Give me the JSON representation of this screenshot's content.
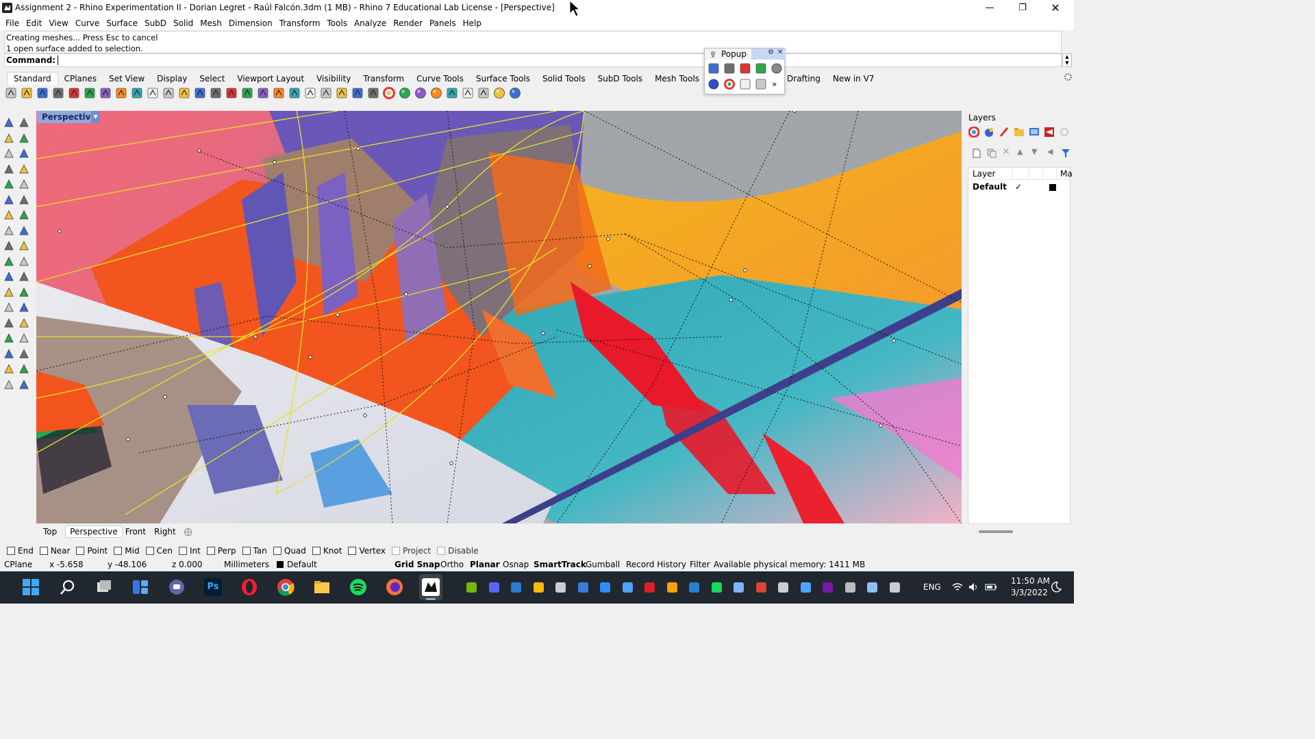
{
  "title_bar": {
    "title": "Assignment 2 - Rhino Experimentation II - Dorian Legret - Raúl Falcón.3dm (1 MB) - Rhino 7 Educational Lab License - [Perspective]",
    "minimize_icon": "minimize-icon",
    "maximize_icon": "restore-icon",
    "close_icon": "close-icon"
  },
  "menu": [
    "File",
    "Edit",
    "View",
    "Curve",
    "Surface",
    "SubD",
    "Solid",
    "Mesh",
    "Dimension",
    "Transform",
    "Tools",
    "Analyze",
    "Render",
    "Panels",
    "Help"
  ],
  "command": {
    "history": [
      "Creating meshes... Press Esc to cancel",
      "1 open surface added to selection."
    ],
    "prompt": "Command:",
    "value": ""
  },
  "toolbar_tabs": [
    "Standard",
    "CPlanes",
    "Set View",
    "Display",
    "Select",
    "Viewport Layout",
    "Visibility",
    "Transform",
    "Curve Tools",
    "Surface Tools",
    "Solid Tools",
    "SubD Tools",
    "Mesh Tools",
    "Drafting",
    "New in V7"
  ],
  "active_tab": "Standard",
  "standard_tools": [
    "new-icon",
    "open-icon",
    "save-icon",
    "print-icon",
    "import-icon",
    "cut-icon",
    "copy-icon",
    "paste-icon",
    "undo-icon",
    "pan-icon",
    "move-view-icon",
    "zoom-icon",
    "zoom-window-icon",
    "zoom-extents-icon",
    "zoom-selected-icon",
    "rotate-view-icon",
    "four-viewports-icon",
    "car-icon",
    "render-preview-icon",
    "snap-icon",
    "named-cplanes-icon",
    "light-icon",
    "lock-icon",
    "material-icon",
    "color-wheel-icon",
    "sphere-shaded-icon",
    "sphere-rendered-icon",
    "sphere-blue-icon",
    "brush-icon",
    "gear-options-icon",
    "grid-options-icon",
    "globe-icon",
    "help-icon"
  ],
  "popup": {
    "title": "Popup",
    "tools": [
      "lightbulb-icon",
      "lock-icon",
      "save-icon",
      "zoom-window-icon",
      "sphere-icon",
      "blue-sphere-icon",
      "color-wheel-icon",
      "bubbles-icon",
      "brush-icon",
      "more-icon"
    ],
    "more": "»"
  },
  "viewport": {
    "label": "Perspective",
    "dropdown_icon": "chevron-down-icon",
    "tabs": [
      "Top",
      "Perspective",
      "Front",
      "Right"
    ],
    "active_tab": "Perspective",
    "add_icon": "add-viewport-icon"
  },
  "layers_panel": {
    "title": "Layers",
    "column_layer": "Layer",
    "column_material": "Ma",
    "rows": [
      {
        "name": "Default",
        "current": "✓",
        "color": "#000000"
      }
    ]
  },
  "osnaps": [
    {
      "label": "End",
      "checked": false
    },
    {
      "label": "Near",
      "checked": false
    },
    {
      "label": "Point",
      "checked": false
    },
    {
      "label": "Mid",
      "checked": false
    },
    {
      "label": "Cen",
      "checked": false
    },
    {
      "label": "Int",
      "checked": false
    },
    {
      "label": "Perp",
      "checked": false
    },
    {
      "label": "Tan",
      "checked": false
    },
    {
      "label": "Quad",
      "checked": false
    },
    {
      "label": "Knot",
      "checked": false
    },
    {
      "label": "Vertex",
      "checked": false
    },
    {
      "label": "Project",
      "checked": false
    },
    {
      "label": "Disable",
      "checked": false
    }
  ],
  "status_bar": {
    "cplane": "CPlane",
    "x": "x -5.658",
    "y": "y -48.106",
    "z": "z 0.000",
    "units": "Millimeters",
    "layer": "Default",
    "grid_snap": "Grid Snap",
    "ortho": "Ortho",
    "planar": "Planar",
    "osnap": "Osnap",
    "smarttrack": "SmartTrack",
    "gumball": "Gumball",
    "record_history": "Record History",
    "filter": "Filter",
    "memory": "Available physical memory: 1411 MB"
  },
  "taskbar": {
    "apps": [
      "windows-start-icon",
      "search-icon",
      "task-view-icon",
      "widgets-icon",
      "teams-chat-icon",
      "photoshop-icon",
      "opera-icon",
      "chrome-icon",
      "file-explorer-icon",
      "spotify-icon",
      "firefox-icon",
      "rhino-icon"
    ],
    "photoshop_label": "Ps",
    "tray": [
      "nvidia-icon",
      "discord-icon",
      "security-icon",
      "google-drive-icon",
      "settings-icon",
      "bluetooth-icon",
      "zoom-icon",
      "display-icon",
      "creative-cloud-icon",
      "warning-shield-icon",
      "defender-icon",
      "spotify-tray-icon",
      "onedrive-icon",
      "chrome-tray-icon",
      "usb-icon",
      "cloud-icon",
      "onenote-icon",
      "printer-icon",
      "task-manager-icon",
      "keyboard-icon"
    ],
    "language": "ENG",
    "time": "11:50 AM",
    "date": "3/3/2022"
  }
}
